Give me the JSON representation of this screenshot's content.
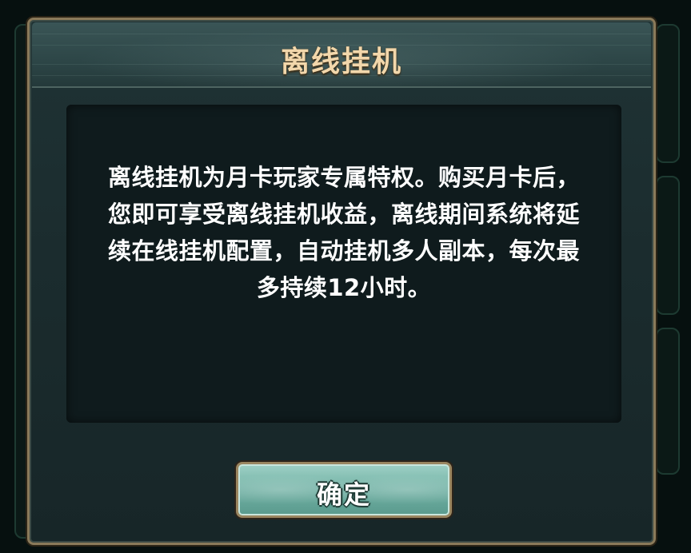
{
  "dialog": {
    "title": "离线挂机",
    "message_lines": [
      "离线挂机为月卡玩家专属特权。购买月卡后，",
      "您即可享受离线挂机收益，离线期间系统将延",
      "续在线挂机配置，自动挂机多人副本，每次最",
      "多持续12小时。"
    ],
    "confirm_label": "确定"
  },
  "colors": {
    "title": "#f2d7ab",
    "frame_gold": "#8a7a5a",
    "button_teal": "#6fb0a3",
    "panel_bg": "#0f1b1d"
  }
}
